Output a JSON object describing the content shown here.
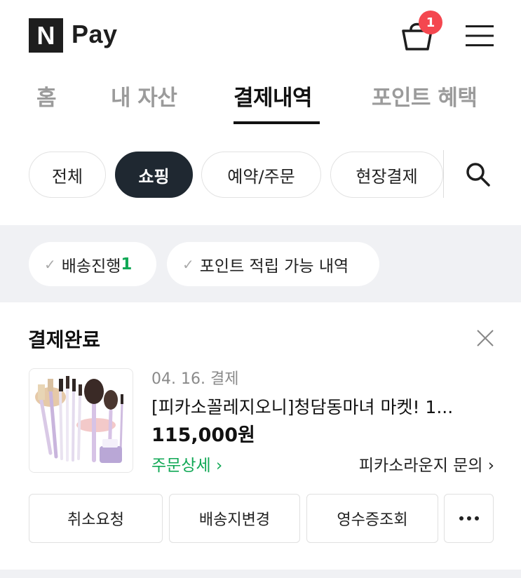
{
  "header": {
    "logo_letter": "N",
    "logo_text": "Pay",
    "cart_badge": "1"
  },
  "tabs": [
    {
      "label": "홈"
    },
    {
      "label": "내 자산"
    },
    {
      "label": "결제내역"
    },
    {
      "label": "포인트 혜택"
    }
  ],
  "filters": [
    {
      "label": "전체"
    },
    {
      "label": "쇼핑"
    },
    {
      "label": "예약/주문"
    },
    {
      "label": "현장결제"
    }
  ],
  "quick_filters": {
    "shipping_label": "배송진행",
    "shipping_count": "1",
    "points_label": "포인트 적립 가능 내역"
  },
  "order": {
    "status": "결제완료",
    "date": "04. 16. 결제",
    "product_name": "[피카소꼴레지오니]청담동마녀 마켓! 1...",
    "price": "115,000원",
    "detail_link": "주문상세 ›",
    "seller_link": "피카소라운지 문의 ›",
    "actions": [
      "취소요청",
      "배송지변경",
      "영수증조회"
    ]
  },
  "colors": {
    "brand_green": "#10a855",
    "badge_red": "#f4474f",
    "active_chip": "#1f2831"
  }
}
